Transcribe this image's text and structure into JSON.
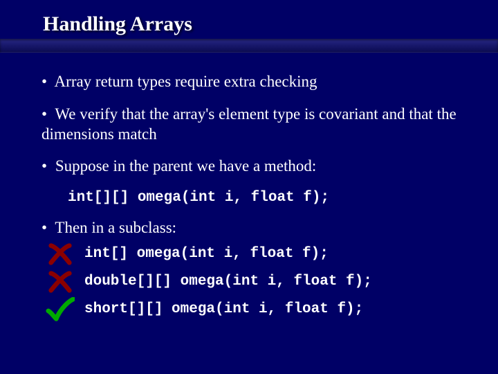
{
  "title": "Handling Arrays",
  "bullets": {
    "b1": "Array return types require extra checking",
    "b2": "We verify that the array's element type is covariant and that the dimensions match",
    "b3": "Suppose in the parent we have a method:",
    "b4": "Then in a subclass:"
  },
  "code": {
    "parent": "int[][] omega(int i, float f);",
    "sub1": "int[] omega(int i, float f);",
    "sub2": "double[][] omega(int i, float f);",
    "sub3": "short[][] omega(int i, float f);"
  },
  "marks": {
    "sub1": "cross",
    "sub2": "cross",
    "sub3": "check"
  },
  "colors": {
    "cross": "#8b0000",
    "check": "#00aa00"
  }
}
